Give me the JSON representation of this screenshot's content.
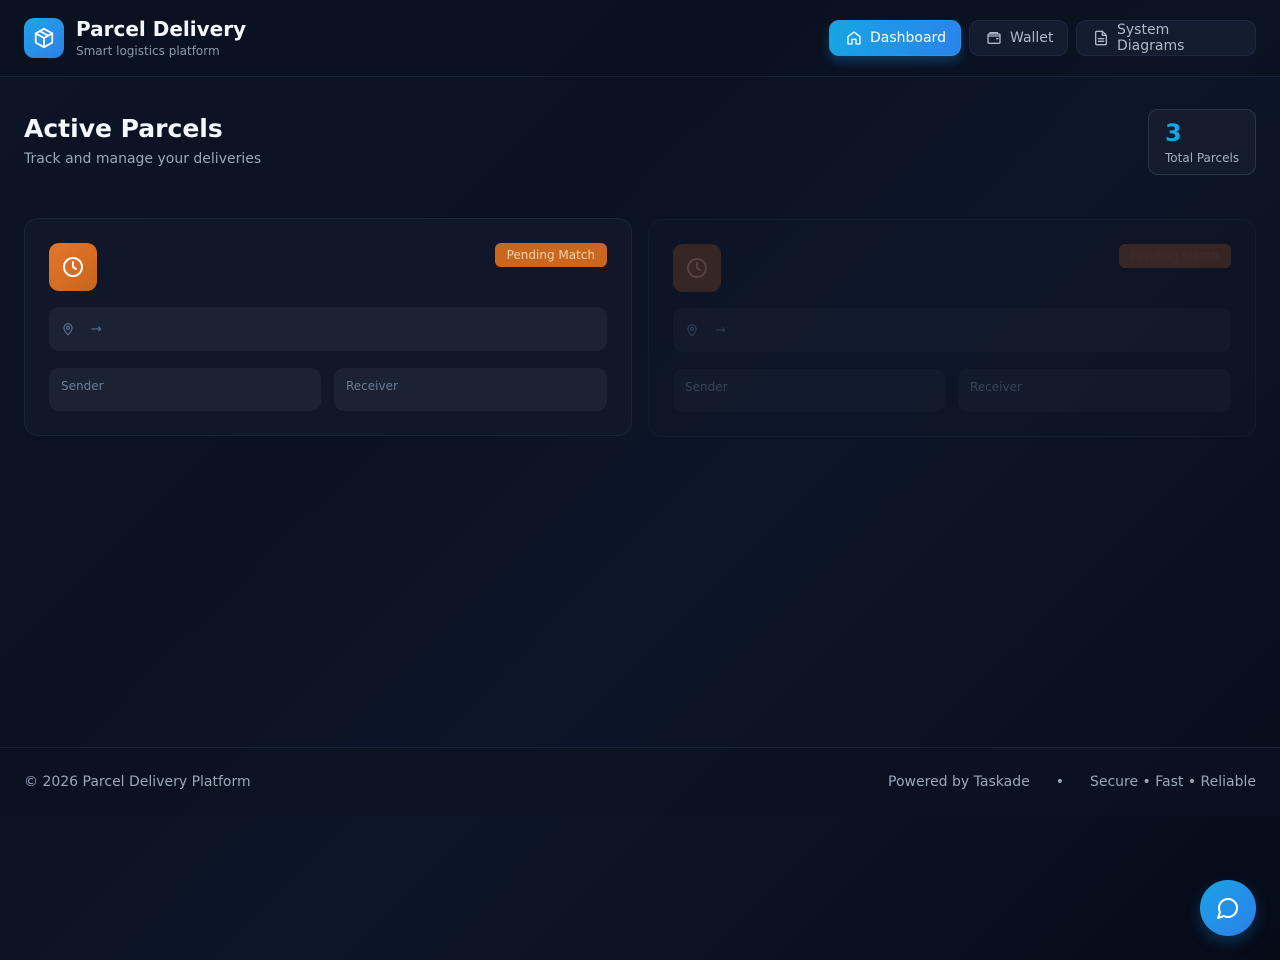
{
  "header": {
    "title": "Parcel Delivery",
    "subtitle": "Smart logistics platform",
    "nav": [
      {
        "label": "Dashboard",
        "icon": "home-icon",
        "active": true
      },
      {
        "label": "Wallet",
        "icon": "wallet-icon",
        "active": false
      },
      {
        "label": "System Diagrams",
        "icon": "document-icon",
        "active": false
      }
    ]
  },
  "main": {
    "title": "Active Parcels",
    "subtitle": "Track and manage your deliveries",
    "stats": {
      "value": "3",
      "label": "Total Parcels"
    },
    "parcels": [
      {
        "status": "Pending Match",
        "route_arrow": "→",
        "sender_label": "Sender",
        "receiver_label": "Receiver"
      },
      {
        "status": "Pending Match",
        "route_arrow": "→",
        "sender_label": "Sender",
        "receiver_label": "Receiver"
      }
    ]
  },
  "footer": {
    "copyright": "© 2026 Parcel Delivery Platform",
    "powered": "Powered by Taskade",
    "separator": "•",
    "tagline": "Secure • Fast • Reliable"
  },
  "colors": {
    "accent": "#1aa2e6",
    "pending": "#c9671f",
    "background": "#0a1122"
  }
}
